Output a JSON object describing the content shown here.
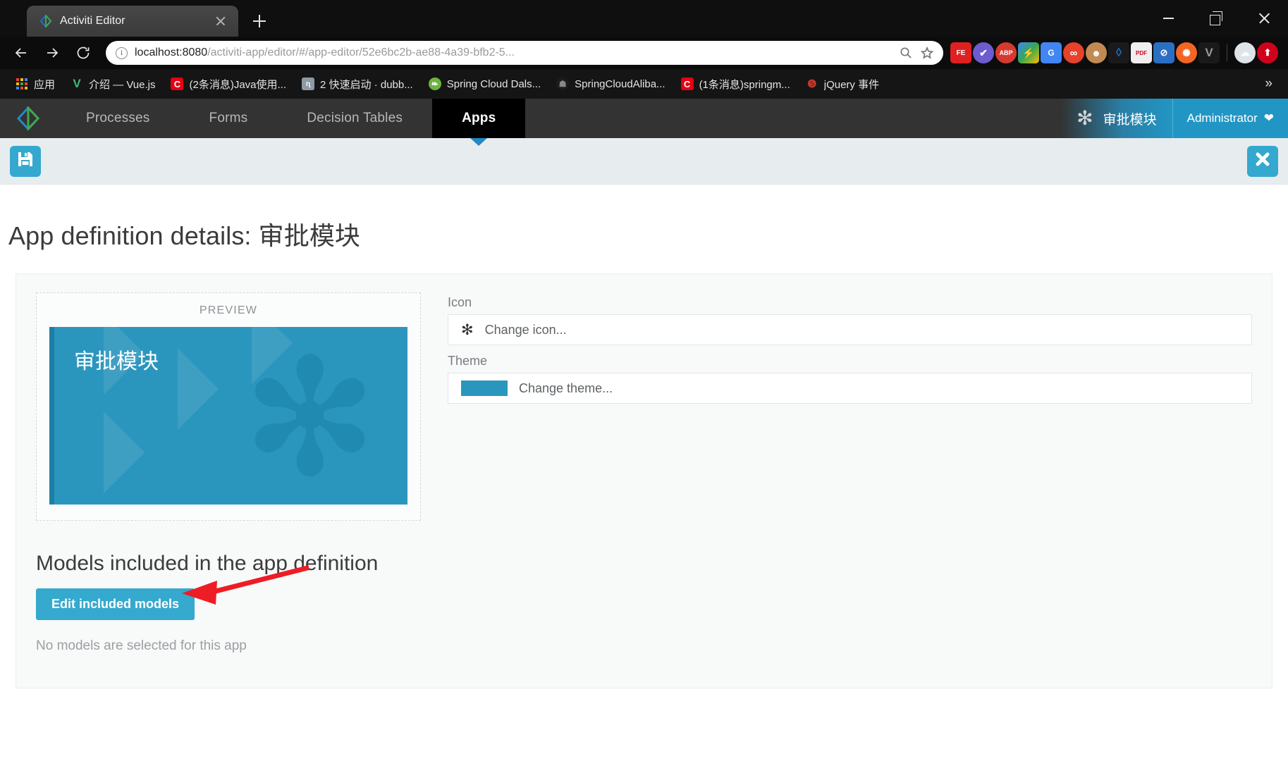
{
  "browser": {
    "tab": {
      "title": "Activiti Editor",
      "favicon": "activiti-diamond-icon",
      "close_icon": "close-icon"
    },
    "new_tab_icon": "plus-icon",
    "window_controls": {
      "minimize": "minimize-icon",
      "maximize": "restore-icon",
      "close": "close-icon"
    },
    "nav": {
      "back_icon": "arrow-left-icon",
      "forward_icon": "arrow-right-icon",
      "reload_icon": "reload-icon",
      "site_info_icon": "info-circle-icon",
      "url_host": "localhost:8080",
      "url_path": "/activiti-app/editor/#/app-editor/52e6bc2b-ae88-4a39-bfb2-5...",
      "search_icon": "search-icon",
      "bookmark_icon": "star-icon"
    },
    "extensions": [
      {
        "name": "fe-extension-icon",
        "label": "FE",
        "color": "#e02020"
      },
      {
        "name": "check-circle-extension-icon",
        "label": "✔",
        "color": "#6d5bd0"
      },
      {
        "name": "adblock-plus-extension-icon",
        "label": "ABP",
        "color": "#d63a2f"
      },
      {
        "name": "lightning-extension-icon",
        "label": "⚡",
        "color": "#4285f4"
      },
      {
        "name": "google-translate-extension-icon",
        "label": "G",
        "color": "#4285f4"
      },
      {
        "name": "infinity-extension-icon",
        "label": "∞",
        "color": "#e8412c"
      },
      {
        "name": "monkey-extension-icon",
        "label": "🐵",
        "color": "#c08a52"
      },
      {
        "name": "leaf-extension-icon",
        "label": "◊",
        "color": "#1a6fc4"
      },
      {
        "name": "pdfjs-extension-icon",
        "label": "PDF",
        "color": "#e8e8e8"
      },
      {
        "name": "block-extension-icon",
        "label": "⛔",
        "color": "#2b6fc2"
      },
      {
        "name": "molecule-extension-icon",
        "label": "✺",
        "color": "#f26522"
      },
      {
        "name": "v-extension-icon",
        "label": "V",
        "color": "#9a9a9a"
      },
      {
        "name": "weather-extension-icon",
        "label": "☁",
        "color": "#dfe4e8"
      },
      {
        "name": "upload-extension-icon",
        "label": "⬆",
        "color": "#d0021b"
      }
    ],
    "bookmarks": [
      {
        "label": "应用",
        "icon": "apps-grid-icon",
        "color": "#f2a900"
      },
      {
        "label": "介绍 — Vue.js",
        "icon": "vuejs-icon",
        "color": "#41b883"
      },
      {
        "label": "(2条消息)Java使用...",
        "icon": "csdn-icon",
        "color": "#e60012"
      },
      {
        "label": "2 快速启动 · dubb...",
        "icon": "dubbo-icon",
        "color": "#8e9aa4"
      },
      {
        "label": "Spring Cloud Dals...",
        "icon": "spring-icon",
        "color": "#6db33f"
      },
      {
        "label": "SpringCloudAliba...",
        "icon": "github-icon",
        "color": "#24292e"
      },
      {
        "label": "(1条消息)springm...",
        "icon": "csdn-icon",
        "color": "#e60012"
      },
      {
        "label": "jQuery 事件",
        "icon": "runoob-icon",
        "color": "#c0392b"
      }
    ],
    "bookmarks_overflow_icon": "chevron-double-right-icon"
  },
  "app": {
    "brand_icon": "activiti-logo-icon",
    "nav_tabs": [
      {
        "label": "Processes",
        "active": false
      },
      {
        "label": "Forms",
        "active": false
      },
      {
        "label": "Decision Tables",
        "active": false
      },
      {
        "label": "Apps",
        "active": true
      }
    ],
    "app_badge": {
      "icon": "asterisk-icon",
      "glyph": "✻",
      "label": "审批模块"
    },
    "user_menu": {
      "label": "Administrator",
      "caret_icon": "chevron-down-icon"
    },
    "toolbar": {
      "save_icon": "save-floppy-icon",
      "close_icon": "close-x-icon"
    },
    "page_title": "App definition details: 审批模块",
    "preview": {
      "label": "PREVIEW",
      "tile_name": "审批模块",
      "tile_icon": "asterisk-icon",
      "tile_glyph": "✻",
      "tile_color": "#2b96bd",
      "tile_accent": "#1d7fa4"
    },
    "fields": [
      {
        "label": "Icon",
        "value": "Change icon...",
        "icon": "asterisk-icon",
        "glyph": "✻",
        "kind": "icon"
      },
      {
        "label": "Theme",
        "value": "Change theme...",
        "swatch_color": "#2b96bd",
        "kind": "theme"
      }
    ],
    "models": {
      "heading": "Models included in the app definition",
      "edit_button": "Edit included models",
      "empty_text": "No models are selected for this app"
    },
    "annotation": {
      "name": "red-arrow-annotation",
      "color": "#ee1c25"
    }
  }
}
